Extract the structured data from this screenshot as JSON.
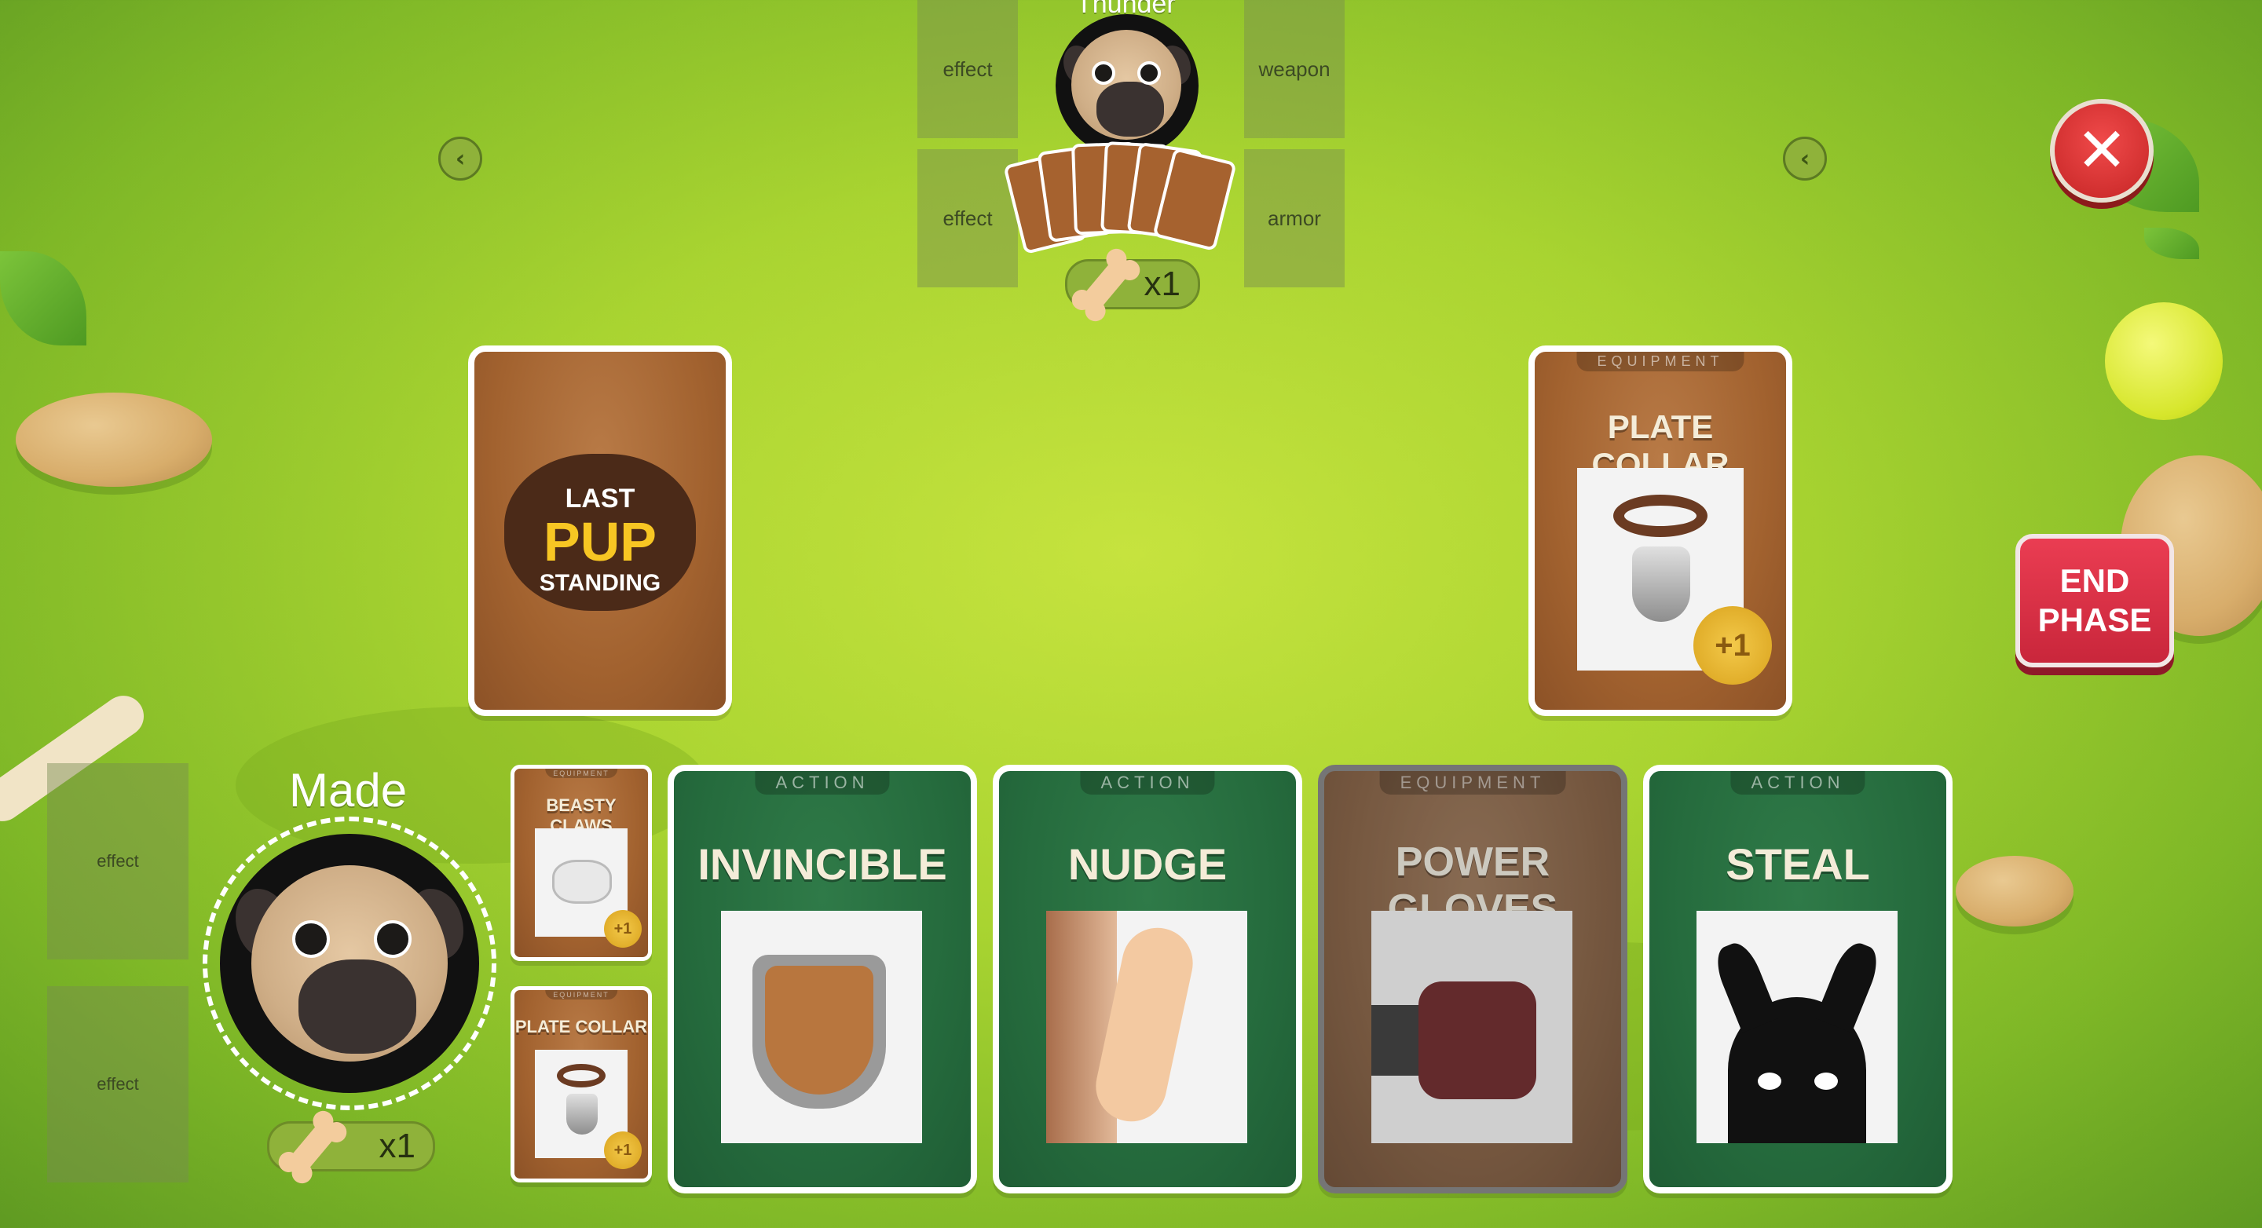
{
  "opponent": {
    "name": "Thunder",
    "slots": {
      "top_left": "effect",
      "bottom_left": "effect",
      "top_right": "weapon",
      "bottom_right": "armor"
    },
    "bone_count": "x1"
  },
  "player": {
    "name": "Made",
    "slots": {
      "top": "effect",
      "bottom": "effect"
    },
    "bone_count": "x1",
    "equipment": [
      {
        "type": "EQUIPMENT",
        "title": "BEASTY CLAWS",
        "badge": "+1"
      },
      {
        "type": "EQUIPMENT",
        "title": "PLATE COLLAR",
        "badge": "+1"
      }
    ]
  },
  "deck": {
    "logo_line1": "LAST",
    "logo_line2": "PUP",
    "logo_line3": "STANDING"
  },
  "discard_card": {
    "type": "EQUIPMENT",
    "title": "PLATE COLLAR",
    "badge": "+1"
  },
  "hand": [
    {
      "type": "ACTION",
      "title": "INVINCIBLE",
      "color": "green",
      "art": "shield-icon"
    },
    {
      "type": "ACTION",
      "title": "NUDGE",
      "color": "green",
      "art": "paw-nudge-icon"
    },
    {
      "type": "EQUIPMENT",
      "title": "POWER GLOVES",
      "color": "brown",
      "art": "glove-icon",
      "disabled": true
    },
    {
      "type": "ACTION",
      "title": "STEAL",
      "color": "green",
      "art": "shadow-creature-icon"
    }
  ],
  "controls": {
    "close": "✕",
    "end_phase_line1": "END",
    "end_phase_line2": "PHASE",
    "arrow_left": "‹",
    "arrow_right": "‹"
  },
  "colors": {
    "grass": "#a9d431",
    "card_green": "#256b3d",
    "card_brown": "#a2622f",
    "end_phase": "#d8303f",
    "close": "#d93434"
  }
}
